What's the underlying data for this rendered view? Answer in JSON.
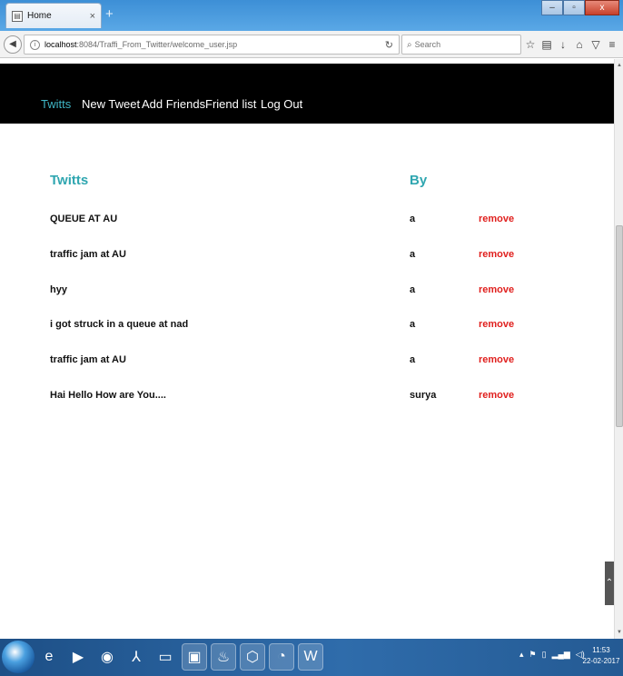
{
  "browser": {
    "tab_title": "Home",
    "tab_close": "×",
    "new_tab": "+",
    "window_controls": {
      "minimize": "–",
      "maximize": "▫",
      "close": "x"
    },
    "url_host": "localhost",
    "url_path": ":8084/Traffi_From_Twitter/welcome_user.jsp",
    "search_placeholder": "Search",
    "icons": [
      "star-icon",
      "reading-list-icon",
      "download-icon",
      "home-icon",
      "pocket-icon",
      "menu-icon"
    ]
  },
  "nav": {
    "items": [
      {
        "label": "Twitts",
        "active": true
      },
      {
        "label": "New Tweet"
      },
      {
        "label": "Add Friends"
      },
      {
        "label": "Friend list"
      },
      {
        "label": "Log Out"
      }
    ]
  },
  "tweets": {
    "heading_text": "Twitts",
    "heading_by": "By",
    "remove_label": "remove",
    "rows": [
      {
        "text": "QUEUE AT AU",
        "by": "a"
      },
      {
        "text": "traffic jam at AU",
        "by": "a"
      },
      {
        "text": "hyy",
        "by": "a"
      },
      {
        "text": "i got struck in a queue at nad",
        "by": "a"
      },
      {
        "text": "traffic jam at AU",
        "by": "a"
      },
      {
        "text": "Hai Hello How are You....",
        "by": "surya"
      }
    ]
  },
  "taskbar": {
    "apps": [
      "ie-icon",
      "media-player-icon",
      "chrome-icon",
      "acrobat-icon",
      "explorer-icon",
      "powerpoint-icon",
      "java-icon",
      "virtualbox-icon",
      "firefox-icon",
      "word-icon"
    ],
    "clock_time": "11:53",
    "clock_date": "22-02-2017"
  },
  "colors": {
    "accent": "#2fa6b0",
    "nav_bg": "#000000",
    "remove": "#e0201e"
  }
}
